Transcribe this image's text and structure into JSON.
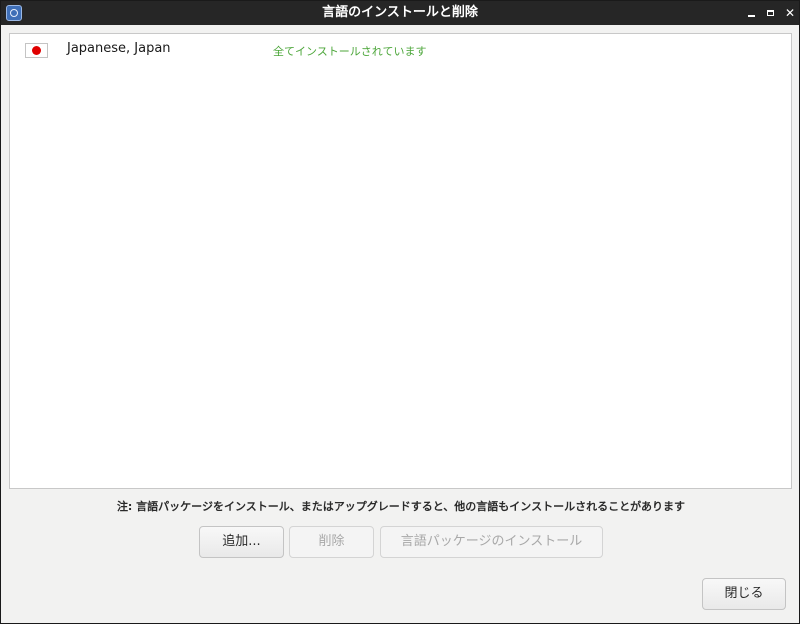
{
  "window": {
    "title": "言語のインストールと削除",
    "controls": {
      "minimize": "minimize",
      "maximize": "maximize",
      "close": "✕"
    }
  },
  "languages": [
    {
      "name": "Japanese, Japan",
      "status": "全てインストールされています",
      "flag": "japan-flag-icon"
    }
  ],
  "colors": {
    "status_installed": "#4ca63a",
    "titlebar": "#262626",
    "flag_red": "#e00000"
  },
  "note": "注: 言語パッケージをインストール、またはアップグレードすると、他の言語もインストールされることがあります",
  "buttons": {
    "add": "追加...",
    "remove": "削除",
    "install_packages": "言語パッケージのインストール",
    "close": "閉じる"
  }
}
